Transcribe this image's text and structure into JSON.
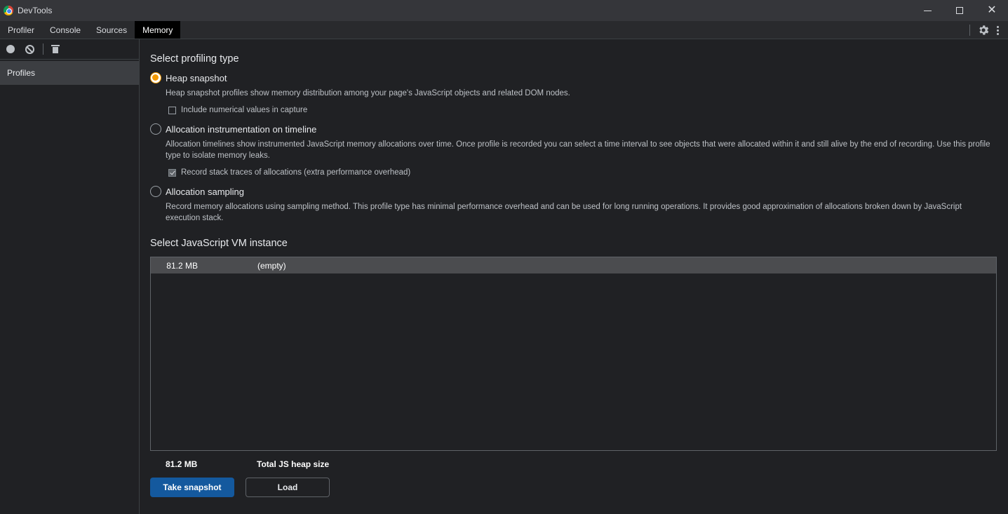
{
  "window": {
    "title": "DevTools"
  },
  "tabs": [
    {
      "label": "Profiler",
      "active": false
    },
    {
      "label": "Console",
      "active": false
    },
    {
      "label": "Sources",
      "active": false
    },
    {
      "label": "Memory",
      "active": true
    }
  ],
  "sidebar": {
    "items": [
      {
        "label": "Profiles",
        "selected": true
      }
    ]
  },
  "profiling": {
    "title": "Select profiling type",
    "options": [
      {
        "label": "Heap snapshot",
        "checked": true,
        "description": "Heap snapshot profiles show memory distribution among your page's JavaScript objects and related DOM nodes.",
        "checkbox": {
          "label": "Include numerical values in capture",
          "checked": false
        }
      },
      {
        "label": "Allocation instrumentation on timeline",
        "checked": false,
        "description": "Allocation timelines show instrumented JavaScript memory allocations over time. Once profile is recorded you can select a time interval to see objects that were allocated within it and still alive by the end of recording. Use this profile type to isolate memory leaks.",
        "checkbox": {
          "label": "Record stack traces of allocations (extra performance overhead)",
          "checked": true
        }
      },
      {
        "label": "Allocation sampling",
        "checked": false,
        "description": "Record memory allocations using sampling method. This profile type has minimal performance overhead and can be used for long running operations. It provides good approximation of allocations broken down by JavaScript execution stack."
      }
    ]
  },
  "vm": {
    "title": "Select JavaScript VM instance",
    "instances": [
      {
        "size": "81.2 MB",
        "name": "(empty)"
      }
    ],
    "total_size": "81.2 MB",
    "total_label": "Total JS heap size"
  },
  "actions": {
    "take_snapshot": "Take snapshot",
    "load": "Load"
  },
  "colors": {
    "accent_radio": "#f29900",
    "primary_button": "#14599e",
    "background": "#202124"
  }
}
